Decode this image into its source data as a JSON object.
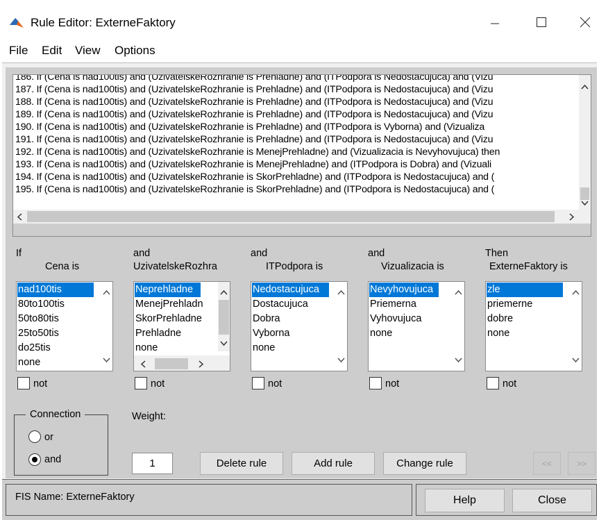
{
  "window": {
    "title": "Rule Editor: ExterneFaktory",
    "minimize_icon": "minimize-icon",
    "maximize_icon": "maximize-icon",
    "close_icon": "close-icon"
  },
  "menu": [
    "File",
    "Edit",
    "View",
    "Options"
  ],
  "rules": [
    "186. If (Cena is nad100tis) and (UzivatelskeRozhranie is Prehladne) and (ITPodpora is Nedostacujuca) and (Vizu",
    "187. If (Cena is nad100tis) and (UzivatelskeRozhranie is Prehladne) and (ITPodpora is Nedostacujuca) and (Vizu",
    "188. If (Cena is nad100tis) and (UzivatelskeRozhranie is Prehladne) and (ITPodpora is Nedostacujuca) and (Vizu",
    "189. If (Cena is nad100tis) and (UzivatelskeRozhranie is Prehladne) and (ITPodpora is Nedostacujuca) and (Vizu",
    "190. If (Cena is nad100tis) and (UzivatelskeRozhranie is Prehladne) and (ITPodpora is Vyborna) and (Vizualiza",
    "191. If (Cena is nad100tis) and (UzivatelskeRozhranie is Prehladne) and (ITPodpora is Nedostacujuca) and (Vizu",
    "192. If (Cena is nad100tis) and (UzivatelskeRozhranie is MenejPrehladne) and (Vizualizacia is Nevyhovujuca) then",
    "193. If (Cena is nad100tis) and (UzivatelskeRozhranie is MenejPrehladne) and (ITPodpora is Dobra) and (Vizuali",
    "194. If (Cena is nad100tis) and (UzivatelskeRozhranie is SkorPrehladne) and (ITPodpora is Nedostacujuca) and (",
    "195. If (Cena is nad100tis) and (UzivatelskeRozhranie is SkorPrehladne) and (ITPodpora is Nedostacujuca) and ("
  ],
  "columns": [
    {
      "prefix": "If",
      "label": "Cena is",
      "items": [
        "nad100tis",
        "80to100tis",
        "50to80tis",
        "25to50tis",
        "do25tis",
        "none"
      ],
      "selected": 0,
      "not_label": "not"
    },
    {
      "prefix": "and",
      "label": "UzivatelskeRozhra",
      "items": [
        "Neprehladne",
        "MenejPrehladn",
        "SkorPrehladne",
        "Prehladne",
        "none"
      ],
      "selected": 0,
      "not_label": "not"
    },
    {
      "prefix": "and",
      "label": "ITPodpora is",
      "items": [
        "Nedostacujuca",
        "Dostacujuca",
        "Dobra",
        "Vyborna",
        "none"
      ],
      "selected": 0,
      "not_label": "not"
    },
    {
      "prefix": "and",
      "label": "Vizualizacia is",
      "items": [
        "Nevyhovujuca",
        "Priemerna",
        "Vyhovujuca",
        "none"
      ],
      "selected": 0,
      "not_label": "not"
    },
    {
      "prefix": "Then",
      "label": "ExterneFaktory is",
      "items": [
        "zle",
        "priemerne",
        "dobre",
        "none"
      ],
      "selected": 0,
      "not_label": "not"
    }
  ],
  "connection": {
    "title": "Connection",
    "options": [
      "or",
      "and"
    ],
    "selected": "and"
  },
  "weight": {
    "label": "Weight:",
    "value": "1"
  },
  "buttons": {
    "delete": "Delete rule",
    "add": "Add rule",
    "change": "Change rule",
    "prev": "<<",
    "next": ">>"
  },
  "status": {
    "fis_name": "FIS Name: ExterneFaktory"
  },
  "footer": {
    "help": "Help",
    "close": "Close"
  },
  "colors": {
    "selection": "#0078d7",
    "panel": "#cdcdcd"
  }
}
